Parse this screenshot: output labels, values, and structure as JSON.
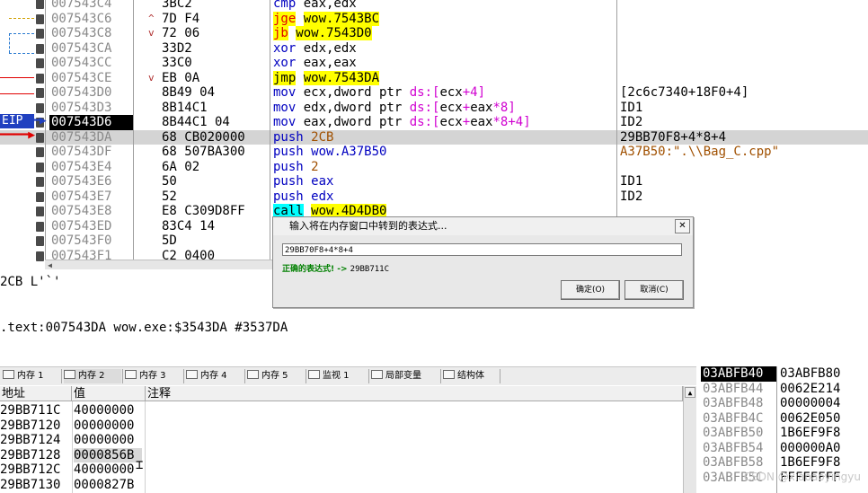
{
  "disasm": {
    "rows": [
      {
        "addr": "007543C4",
        "hex": "3BC2",
        "marker": "",
        "asm": [
          [
            "mnem",
            "cmp "
          ],
          [
            "reg",
            "eax,edx"
          ]
        ],
        "comment": ""
      },
      {
        "addr": "007543C6",
        "hex": "7D F4",
        "marker": "^",
        "asm": [
          [
            "jcc",
            "jge"
          ],
          [
            "reg",
            " "
          ],
          [
            "jmp",
            "wow.7543BC"
          ]
        ],
        "comment": ""
      },
      {
        "addr": "007543C8",
        "hex": "72 06",
        "marker": "v",
        "asm": [
          [
            "jcc",
            "jb"
          ],
          [
            "reg",
            " "
          ],
          [
            "jmp",
            "wow.7543D0"
          ]
        ],
        "comment": ""
      },
      {
        "addr": "007543CA",
        "hex": "33D2",
        "marker": "",
        "asm": [
          [
            "mnem",
            "xor "
          ],
          [
            "reg",
            "edx,edx"
          ]
        ],
        "comment": ""
      },
      {
        "addr": "007543CC",
        "hex": "33C0",
        "marker": "",
        "asm": [
          [
            "mnem",
            "xor "
          ],
          [
            "reg",
            "eax,eax"
          ]
        ],
        "comment": ""
      },
      {
        "addr": "007543CE",
        "hex": "EB 0A",
        "marker": "v",
        "asm": [
          [
            "jmp",
            "jmp"
          ],
          [
            "reg",
            " "
          ],
          [
            "jmp",
            "wow.7543DA"
          ]
        ],
        "comment": ""
      },
      {
        "addr": "007543D0",
        "hex": "8B49 04",
        "marker": "",
        "asm": [
          [
            "mnem",
            "mov "
          ],
          [
            "reg",
            "ecx,dword ptr "
          ],
          [
            "seg",
            "ds:["
          ],
          [
            "reg",
            "ecx"
          ],
          [
            "seg",
            "+4]"
          ]
        ],
        "comment": "[2c6c7340+18F0+4]"
      },
      {
        "addr": "007543D3",
        "hex": "8B14C1",
        "marker": "",
        "asm": [
          [
            "mnem",
            "mov "
          ],
          [
            "reg",
            "edx,dword ptr "
          ],
          [
            "seg",
            "ds:["
          ],
          [
            "reg",
            "ecx"
          ],
          [
            "seg",
            "+"
          ],
          [
            "reg",
            "eax"
          ],
          [
            "seg",
            "*8]"
          ]
        ],
        "comment": "ID1"
      },
      {
        "addr": "007543D6",
        "hex": "8B44C1 04",
        "marker": "",
        "asm": [
          [
            "mnem",
            "mov "
          ],
          [
            "reg",
            "eax,dword ptr "
          ],
          [
            "seg",
            "ds:["
          ],
          [
            "reg",
            "ecx"
          ],
          [
            "seg",
            "+"
          ],
          [
            "reg",
            "eax"
          ],
          [
            "seg",
            "*8+4]"
          ]
        ],
        "comment": "ID2"
      },
      {
        "addr": "007543DA",
        "hex": "68 CB020000",
        "marker": "",
        "asm": [
          [
            "push",
            "push "
          ],
          [
            "cmt-str",
            "2CB"
          ]
        ],
        "comment": "29BB70F8+4*8+4"
      },
      {
        "addr": "007543DF",
        "hex": "68 507BA300",
        "marker": "",
        "asm": [
          [
            "push",
            "push "
          ],
          [
            "push",
            "wow.A37B50"
          ]
        ],
        "comment": "A37B50:\".\\\\Bag_C.cpp\""
      },
      {
        "addr": "007543E4",
        "hex": "6A 02",
        "marker": "",
        "asm": [
          [
            "push",
            "push "
          ],
          [
            "cmt-str",
            "2"
          ]
        ],
        "comment": ""
      },
      {
        "addr": "007543E6",
        "hex": "50",
        "marker": "",
        "asm": [
          [
            "push",
            "push "
          ],
          [
            "push",
            "eax"
          ]
        ],
        "comment": "ID1"
      },
      {
        "addr": "007543E7",
        "hex": "52",
        "marker": "",
        "asm": [
          [
            "push",
            "push "
          ],
          [
            "push",
            "edx"
          ]
        ],
        "comment": "ID2"
      },
      {
        "addr": "007543E8",
        "hex": "E8 C309D8FF",
        "marker": "",
        "asm": [
          [
            "call",
            "call"
          ],
          [
            "reg",
            " "
          ],
          [
            "jmp",
            "wow.4D4DB0"
          ]
        ],
        "comment": ""
      },
      {
        "addr": "007543ED",
        "hex": "83C4 14",
        "marker": "",
        "asm": [],
        "comment": ""
      },
      {
        "addr": "007543F0",
        "hex": "5D",
        "marker": "",
        "asm": [],
        "comment": ""
      },
      {
        "addr": "007543F1",
        "hex": "C2 0400",
        "marker": "",
        "asm": [],
        "comment": ""
      }
    ],
    "current_addr_index": 8,
    "selected_row_index": 9,
    "eip_label": "EIP"
  },
  "info": {
    "line1": "2CB L'`'",
    "line2": ".text:007543DA wow.exe:$3543DA #3537DA"
  },
  "dialog": {
    "title": "输入将在内存窗口中转到的表达式...",
    "close": "✕",
    "expression": "29BB70F8+4*8+4",
    "status_ok": "正确的表达式!",
    "status_arrow": " -> ",
    "status_value": "29BB711C",
    "ok_label": "确定(O)",
    "cancel_label": "取消(C)"
  },
  "tabs": [
    {
      "label": "内存 1",
      "active": false
    },
    {
      "label": "内存 2",
      "active": true
    },
    {
      "label": "内存 3",
      "active": false
    },
    {
      "label": "内存 4",
      "active": false
    },
    {
      "label": "内存 5",
      "active": false
    },
    {
      "label": "监视 1",
      "active": false
    },
    {
      "label": "局部变量",
      "active": false
    },
    {
      "label": "结构体",
      "active": false
    }
  ],
  "memory": {
    "headers": {
      "addr": "地址",
      "value": "值",
      "comment": "注释"
    },
    "rows": [
      {
        "addr": "29BB711C",
        "value": "40000000"
      },
      {
        "addr": "29BB7120",
        "value": "00000000"
      },
      {
        "addr": "29BB7124",
        "value": "00000000"
      },
      {
        "addr": "29BB7128",
        "value": "0000856B"
      },
      {
        "addr": "29BB712C",
        "value": "40000000"
      },
      {
        "addr": "29BB7130",
        "value": "0000827B"
      }
    ],
    "highlight_index": 3
  },
  "stack": {
    "rows": [
      {
        "addr": "03ABFB40",
        "value": "03ABFB80"
      },
      {
        "addr": "03ABFB44",
        "value": "0062E214"
      },
      {
        "addr": "03ABFB48",
        "value": "00000004"
      },
      {
        "addr": "03ABFB4C",
        "value": "0062E050"
      },
      {
        "addr": "03ABFB50",
        "value": "1B6EF9F8"
      },
      {
        "addr": "03ABFB54",
        "value": "000000A0"
      },
      {
        "addr": "03ABFB58",
        "value": "1B6EF9F8"
      },
      {
        "addr": "03ABFB5C",
        "value": "FFFFFFFF"
      }
    ],
    "current_index": 0
  },
  "watermark": "CSDN @xiaoaoyingyu"
}
